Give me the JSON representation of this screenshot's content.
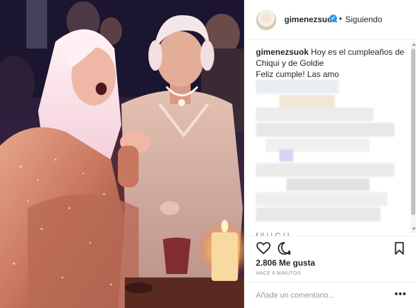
{
  "post": {
    "username": "gimenezsuok",
    "verified_mark": "✓",
    "separator": "•",
    "follow_status": "Siguiendo",
    "caption": {
      "username": "gimenezsuok",
      "line1": "Hoy es el cumpleaños de",
      "line2": "Chiqui y de Goldie",
      "line3": "Feliz cumple! Las amo"
    },
    "truncated_comment": "f ll        l  l  C  l       l",
    "likes": "2.806 Me gusta",
    "time_ago": "HACE 6 MINUTOS",
    "comment_placeholder": "Añade un comentario...",
    "more_label": "•••"
  },
  "icons": {
    "like": "heart-icon",
    "comment": "speech-bubble-icon",
    "save": "bookmark-icon",
    "verified": "verified-badge-icon",
    "avatar": "profile-avatar"
  },
  "colors": {
    "text": "#262626",
    "muted": "#8e8e8e",
    "verified": "#3897f0",
    "border": "#efefef"
  }
}
